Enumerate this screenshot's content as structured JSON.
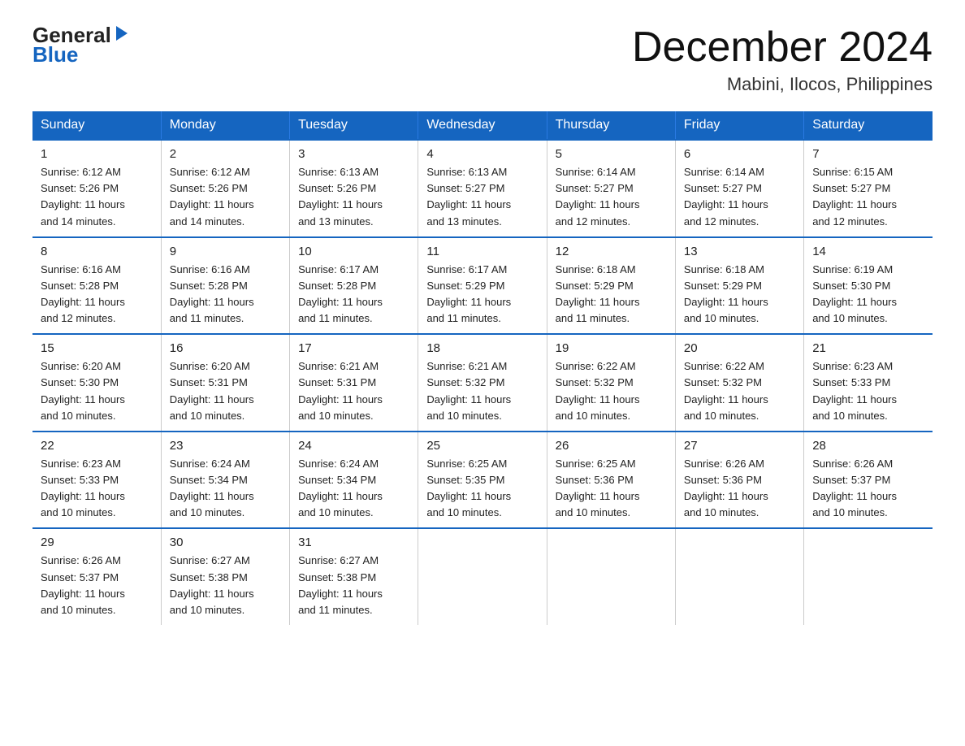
{
  "logo": {
    "general": "General",
    "blue": "Blue",
    "arrow_unicode": "▶"
  },
  "title": {
    "month": "December 2024",
    "location": "Mabini, Ilocos, Philippines"
  },
  "headers": [
    "Sunday",
    "Monday",
    "Tuesday",
    "Wednesday",
    "Thursday",
    "Friday",
    "Saturday"
  ],
  "weeks": [
    [
      {
        "day": "1",
        "info": "Sunrise: 6:12 AM\nSunset: 5:26 PM\nDaylight: 11 hours\nand 14 minutes."
      },
      {
        "day": "2",
        "info": "Sunrise: 6:12 AM\nSunset: 5:26 PM\nDaylight: 11 hours\nand 14 minutes."
      },
      {
        "day": "3",
        "info": "Sunrise: 6:13 AM\nSunset: 5:26 PM\nDaylight: 11 hours\nand 13 minutes."
      },
      {
        "day": "4",
        "info": "Sunrise: 6:13 AM\nSunset: 5:27 PM\nDaylight: 11 hours\nand 13 minutes."
      },
      {
        "day": "5",
        "info": "Sunrise: 6:14 AM\nSunset: 5:27 PM\nDaylight: 11 hours\nand 12 minutes."
      },
      {
        "day": "6",
        "info": "Sunrise: 6:14 AM\nSunset: 5:27 PM\nDaylight: 11 hours\nand 12 minutes."
      },
      {
        "day": "7",
        "info": "Sunrise: 6:15 AM\nSunset: 5:27 PM\nDaylight: 11 hours\nand 12 minutes."
      }
    ],
    [
      {
        "day": "8",
        "info": "Sunrise: 6:16 AM\nSunset: 5:28 PM\nDaylight: 11 hours\nand 12 minutes."
      },
      {
        "day": "9",
        "info": "Sunrise: 6:16 AM\nSunset: 5:28 PM\nDaylight: 11 hours\nand 11 minutes."
      },
      {
        "day": "10",
        "info": "Sunrise: 6:17 AM\nSunset: 5:28 PM\nDaylight: 11 hours\nand 11 minutes."
      },
      {
        "day": "11",
        "info": "Sunrise: 6:17 AM\nSunset: 5:29 PM\nDaylight: 11 hours\nand 11 minutes."
      },
      {
        "day": "12",
        "info": "Sunrise: 6:18 AM\nSunset: 5:29 PM\nDaylight: 11 hours\nand 11 minutes."
      },
      {
        "day": "13",
        "info": "Sunrise: 6:18 AM\nSunset: 5:29 PM\nDaylight: 11 hours\nand 10 minutes."
      },
      {
        "day": "14",
        "info": "Sunrise: 6:19 AM\nSunset: 5:30 PM\nDaylight: 11 hours\nand 10 minutes."
      }
    ],
    [
      {
        "day": "15",
        "info": "Sunrise: 6:20 AM\nSunset: 5:30 PM\nDaylight: 11 hours\nand 10 minutes."
      },
      {
        "day": "16",
        "info": "Sunrise: 6:20 AM\nSunset: 5:31 PM\nDaylight: 11 hours\nand 10 minutes."
      },
      {
        "day": "17",
        "info": "Sunrise: 6:21 AM\nSunset: 5:31 PM\nDaylight: 11 hours\nand 10 minutes."
      },
      {
        "day": "18",
        "info": "Sunrise: 6:21 AM\nSunset: 5:32 PM\nDaylight: 11 hours\nand 10 minutes."
      },
      {
        "day": "19",
        "info": "Sunrise: 6:22 AM\nSunset: 5:32 PM\nDaylight: 11 hours\nand 10 minutes."
      },
      {
        "day": "20",
        "info": "Sunrise: 6:22 AM\nSunset: 5:32 PM\nDaylight: 11 hours\nand 10 minutes."
      },
      {
        "day": "21",
        "info": "Sunrise: 6:23 AM\nSunset: 5:33 PM\nDaylight: 11 hours\nand 10 minutes."
      }
    ],
    [
      {
        "day": "22",
        "info": "Sunrise: 6:23 AM\nSunset: 5:33 PM\nDaylight: 11 hours\nand 10 minutes."
      },
      {
        "day": "23",
        "info": "Sunrise: 6:24 AM\nSunset: 5:34 PM\nDaylight: 11 hours\nand 10 minutes."
      },
      {
        "day": "24",
        "info": "Sunrise: 6:24 AM\nSunset: 5:34 PM\nDaylight: 11 hours\nand 10 minutes."
      },
      {
        "day": "25",
        "info": "Sunrise: 6:25 AM\nSunset: 5:35 PM\nDaylight: 11 hours\nand 10 minutes."
      },
      {
        "day": "26",
        "info": "Sunrise: 6:25 AM\nSunset: 5:36 PM\nDaylight: 11 hours\nand 10 minutes."
      },
      {
        "day": "27",
        "info": "Sunrise: 6:26 AM\nSunset: 5:36 PM\nDaylight: 11 hours\nand 10 minutes."
      },
      {
        "day": "28",
        "info": "Sunrise: 6:26 AM\nSunset: 5:37 PM\nDaylight: 11 hours\nand 10 minutes."
      }
    ],
    [
      {
        "day": "29",
        "info": "Sunrise: 6:26 AM\nSunset: 5:37 PM\nDaylight: 11 hours\nand 10 minutes."
      },
      {
        "day": "30",
        "info": "Sunrise: 6:27 AM\nSunset: 5:38 PM\nDaylight: 11 hours\nand 10 minutes."
      },
      {
        "day": "31",
        "info": "Sunrise: 6:27 AM\nSunset: 5:38 PM\nDaylight: 11 hours\nand 11 minutes."
      },
      {
        "day": "",
        "info": ""
      },
      {
        "day": "",
        "info": ""
      },
      {
        "day": "",
        "info": ""
      },
      {
        "day": "",
        "info": ""
      }
    ]
  ]
}
